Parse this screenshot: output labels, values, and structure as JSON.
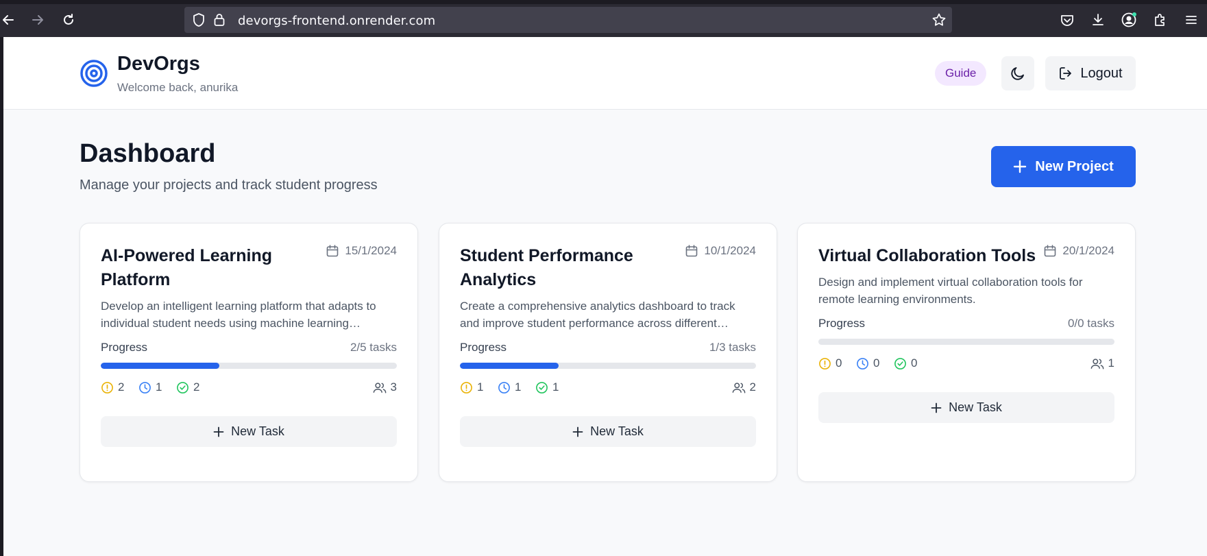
{
  "browser": {
    "url": "devorgs-frontend.onrender.com"
  },
  "header": {
    "brand": "DevOrgs",
    "welcome": "Welcome back, anurika",
    "guide_label": "Guide",
    "logout_label": "Logout"
  },
  "main": {
    "title": "Dashboard",
    "subtitle": "Manage your projects and track student progress",
    "new_project_label": "New Project"
  },
  "colors": {
    "primary": "#2563eb",
    "pending": "#eab308",
    "in_progress": "#3b82f6",
    "done": "#22c55e",
    "guide_bg": "#f3e8ff"
  },
  "projects": [
    {
      "title": "AI-Powered Learning Platform",
      "date": "15/1/2024",
      "description": "Develop an intelligent learning platform that adapts to individual student needs using machine learning algorithms.",
      "progress_label": "Progress",
      "tasks_text": "2/5 tasks",
      "progress_fraction": 0.4,
      "pending": "2",
      "in_progress": "1",
      "done": "2",
      "members": "3",
      "new_task_label": "New Task"
    },
    {
      "title": "Student Performance Analytics",
      "date": "10/1/2024",
      "description": "Create a comprehensive analytics dashboard to track and improve student performance across different subjects.",
      "progress_label": "Progress",
      "tasks_text": "1/3 tasks",
      "progress_fraction": 0.333,
      "pending": "1",
      "in_progress": "1",
      "done": "1",
      "members": "2",
      "new_task_label": "New Task"
    },
    {
      "title": "Virtual Collaboration Tools",
      "date": "20/1/2024",
      "description": "Design and implement virtual collaboration tools for remote learning environments.",
      "progress_label": "Progress",
      "tasks_text": "0/0 tasks",
      "progress_fraction": 0,
      "pending": "0",
      "in_progress": "0",
      "done": "0",
      "members": "1",
      "new_task_label": "New Task"
    }
  ]
}
